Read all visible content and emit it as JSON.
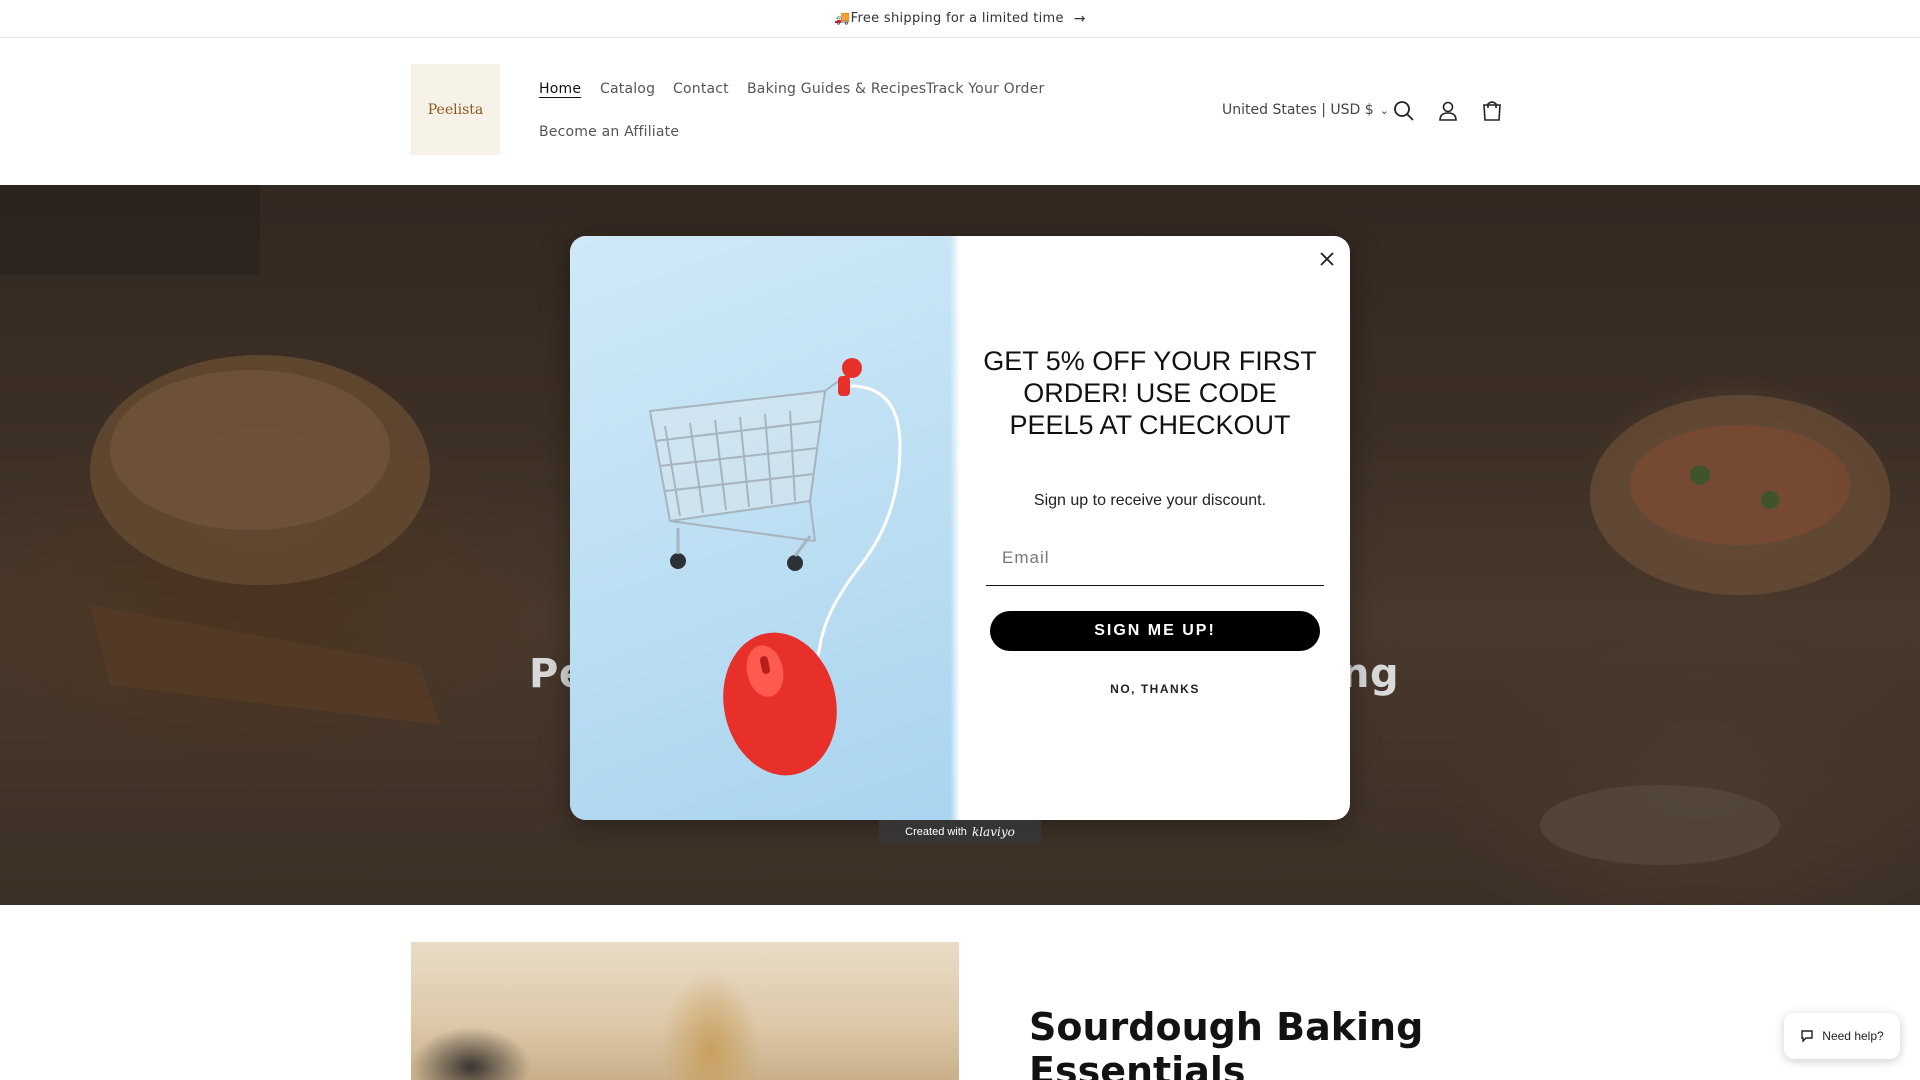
{
  "announcement": {
    "emoji": "🚚",
    "text": "Free shipping for a limited time",
    "arrow": "→"
  },
  "header": {
    "logo_text": "Peelista",
    "nav": [
      {
        "label": "Home",
        "active": true
      },
      {
        "label": "Catalog"
      },
      {
        "label": "Contact"
      },
      {
        "label": "Baking Guides & Recipes"
      },
      {
        "label": "Track Your Order"
      },
      {
        "label": "Become an Affiliate"
      }
    ],
    "locale": "United States | USD $",
    "icons": [
      "search-icon",
      "account-icon",
      "cart-icon"
    ]
  },
  "hero": {
    "title_left": "Pe",
    "title_right": "ng"
  },
  "popup": {
    "headline": "GET 5% OFF YOUR FIRST ORDER! USE CODE PEEL5 AT CHECKOUT",
    "subtext": "Sign up to receive your discount.",
    "email_placeholder": "Email",
    "submit_label": "SIGN ME UP!",
    "decline_label": "NO, THANKS",
    "badge_prefix": "Created with",
    "badge_brand": "klaviyo"
  },
  "feature": {
    "title_line1": "Sourdough Baking",
    "title_line2": "Essentials"
  },
  "chat": {
    "label": "Need help?"
  },
  "colors": {
    "cart_red": "#e8302a",
    "button_black": "#000000",
    "popup_blue": "#bfe0f3"
  }
}
